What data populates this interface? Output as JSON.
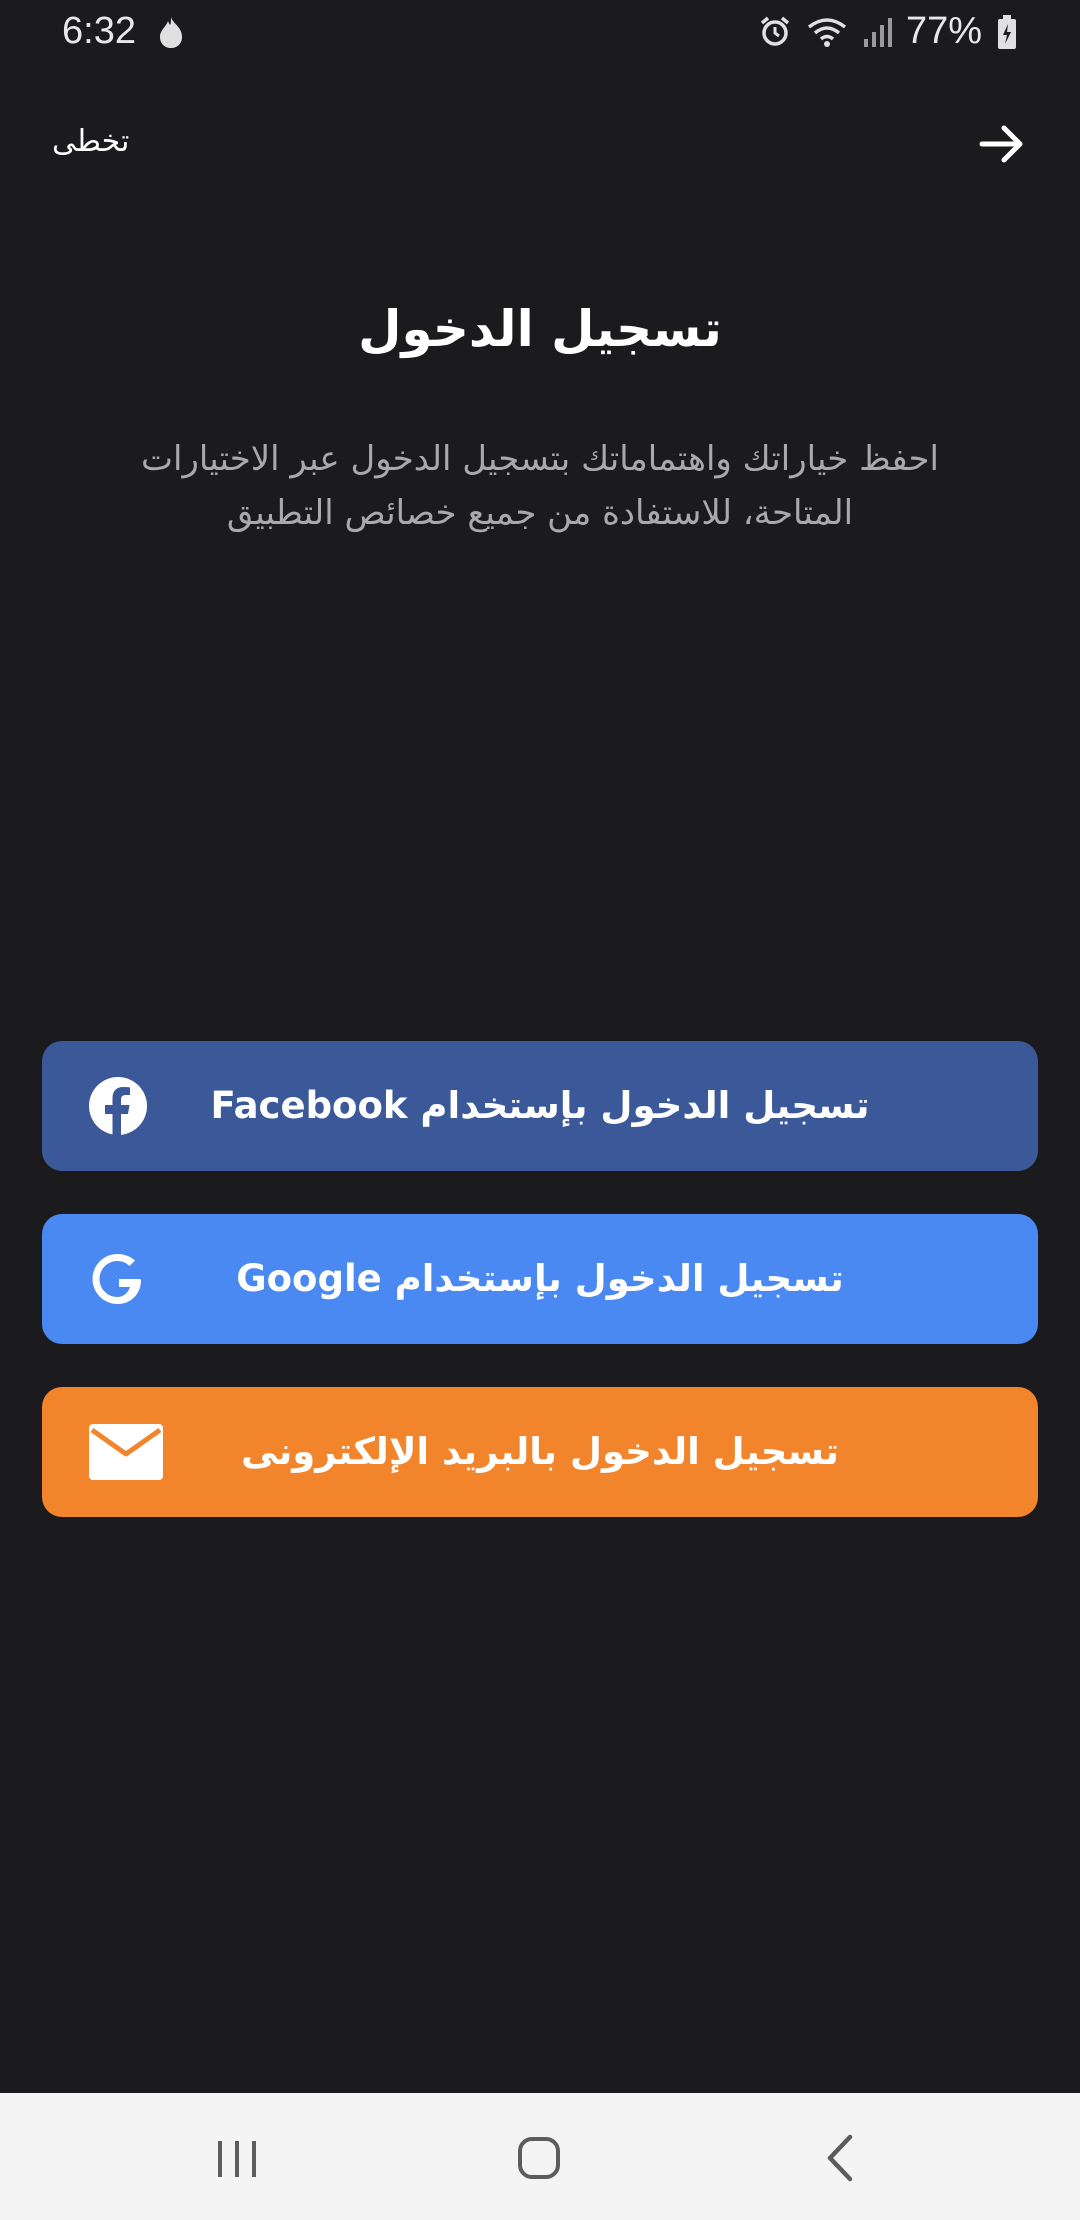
{
  "status_bar": {
    "time": "6:32",
    "battery": "77%"
  },
  "top_bar": {
    "skip_label": "تخطى"
  },
  "title": "تسجيل الدخول",
  "subtitle": "احفظ خياراتك واهتماماتك بتسجيل الدخول عبر الاختيارات المتاحة، للاستفادة من جميع خصائص التطبيق",
  "buttons": [
    {
      "label": "تسجيل الدخول بإستخدام Facebook",
      "icon": "facebook-icon",
      "color": "#3b5998"
    },
    {
      "label": "تسجيل الدخول بإستخدام Google",
      "icon": "google-icon",
      "color": "#4a89f2"
    },
    {
      "label": "تسجيل الدخول بالبريد الإلكترونى",
      "icon": "envelope-icon",
      "color": "#f2852c"
    }
  ],
  "colors": {
    "background": "#1b1b1d",
    "subtitle": "#a9a9ad",
    "nav_bar": "#f4f4f4"
  }
}
